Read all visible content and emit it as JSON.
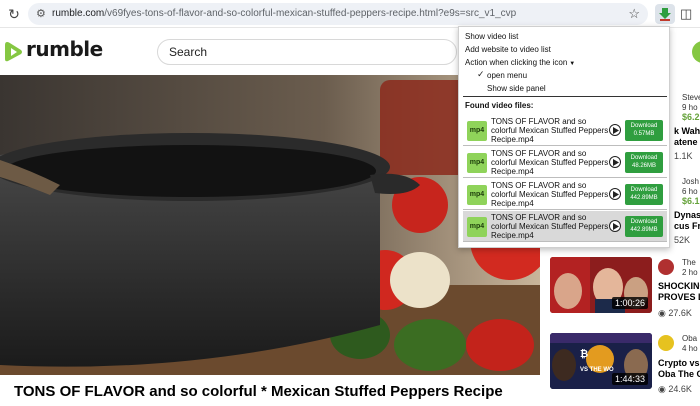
{
  "browser": {
    "url_domain": "rumble.com",
    "url_path": "/v69fyes-tons-of-flavor-and-so-colorful-mexican-stuffed-peppers-recipe.html?e9s=src_v1_cvp"
  },
  "site": {
    "logo_text": "rumble",
    "search_placeholder": "Search",
    "brand_color": "#85c742"
  },
  "video": {
    "title": "TONS OF FLAVOR and so colorful * Mexican Stuffed Peppers Recipe"
  },
  "sidebar": {
    "items": [
      {
        "channel": "Steve",
        "meta": "9 ho",
        "rant": "$6.2",
        "title_l1": "k Wah",
        "title_l2": "atene",
        "views": "1.1K"
      },
      {
        "channel": "Josh",
        "meta": "6 ho",
        "rant": "$6.1",
        "title_l1": "Dynas",
        "title_l2": "cus Fr",
        "views": "52K"
      },
      {
        "channel": "The",
        "meta": "2 ho",
        "title_l1": "SHOCKING",
        "title_l2": "PROVES L",
        "views": "27.6K",
        "duration": "1:00:26"
      },
      {
        "channel": "Oba",
        "meta": "4 ho",
        "title_l1": "Crypto vs",
        "title_l2": "Oba The G",
        "views": "24.6K",
        "duration": "1:44:33",
        "thumb_text": "VS THE WO"
      }
    ]
  },
  "popup": {
    "show_list": "Show video list",
    "add_website": "Add website to video list",
    "action_label": "Action when clicking the icon",
    "opt_open_menu": "open menu",
    "opt_side_panel": "Show side panel",
    "found_label": "Found video files:",
    "badge": "mp4",
    "files": [
      {
        "name": "TONS OF FLAVOR and so colorful Mexican Stuffed Peppers Recipe.mp4",
        "dl": "Download",
        "size": "0.57MB"
      },
      {
        "name": "TONS OF FLAVOR and so colorful Mexican Stuffed Peppers Recipe.mp4",
        "dl": "Download",
        "size": "48.26MB"
      },
      {
        "name": "TONS OF FLAVOR and so colorful Mexican Stuffed Peppers Recipe.mp4",
        "dl": "Download",
        "size": "442.89MB"
      },
      {
        "name": "TONS OF FLAVOR and so colorful Mexican Stuffed Peppers Recipe.mp4",
        "dl": "Download",
        "size": "442.89MB"
      }
    ]
  }
}
